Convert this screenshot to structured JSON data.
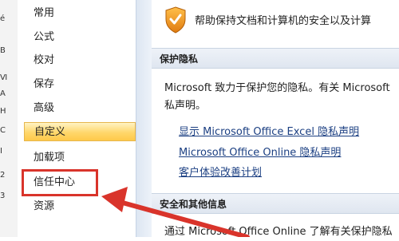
{
  "left_strip": {
    "fragments": [
      "é",
      "B",
      "Ⅵ",
      "A",
      "H",
      "C",
      "I",
      "2",
      "3"
    ]
  },
  "nav": {
    "items": [
      {
        "label": "常用",
        "selected": false
      },
      {
        "label": "公式",
        "selected": false
      },
      {
        "label": "校对",
        "selected": false
      },
      {
        "label": "保存",
        "selected": false
      },
      {
        "label": "高级",
        "selected": false
      },
      {
        "label": "自定义",
        "selected": true
      },
      {
        "label": "加载项",
        "selected": false
      },
      {
        "label": "信任中心",
        "selected": false
      },
      {
        "label": "资源",
        "selected": false
      }
    ]
  },
  "content": {
    "banner_text": "帮助保持文档和计算机的安全以及计算",
    "privacy": {
      "header": "保护隐私",
      "para_line1": "Microsoft 致力于保护您的隐私。有关 Microsoft",
      "para_line2": "私声明。",
      "links": [
        "显示 Microsoft Office Excel 隐私声明",
        "Microsoft Office Online 隐私声明",
        "客户体验改善计划"
      ]
    },
    "security": {
      "header": "安全和其他信息",
      "para_line1": "通过 Microsoft Office Online 了解有关保护隐私"
    }
  },
  "colors": {
    "selected_gradient_start": "#fff3c4",
    "selected_gradient_end": "#ffc94a",
    "highlight_red": "#d9342b",
    "link_blue": "#1b3f82",
    "shield_orange": "#f19a1d"
  },
  "icons": {
    "banner": "shield-icon",
    "annotation": "red-arrow"
  }
}
